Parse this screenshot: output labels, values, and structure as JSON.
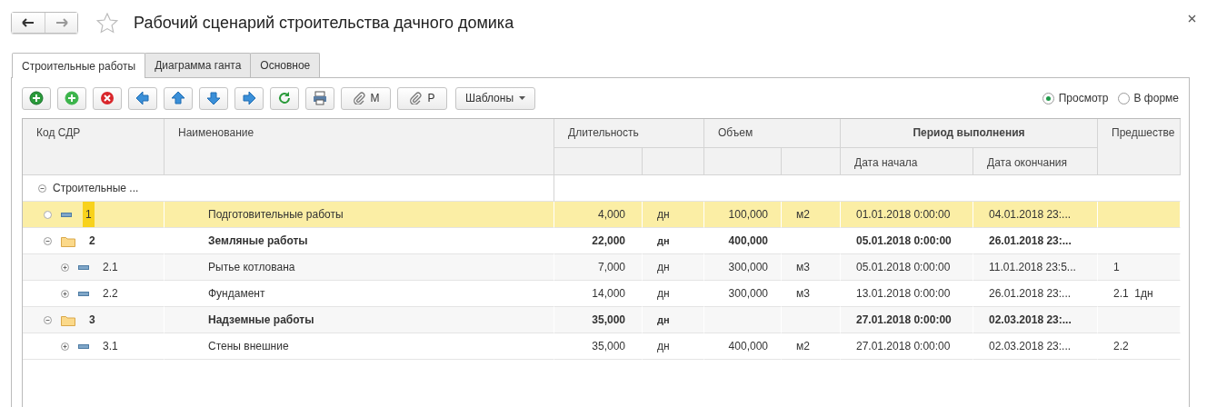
{
  "window": {
    "title": "Рабочий сценарий строительства дачного домика"
  },
  "tabs": [
    {
      "label": "Строительные работы",
      "selected": true
    },
    {
      "label": "Диаграмма ганта",
      "selected": false
    },
    {
      "label": "Основное",
      "selected": false
    }
  ],
  "toolbar": {
    "attach_buttons": [
      {
        "label": "М"
      },
      {
        "label": "Р"
      }
    ],
    "templates_button": {
      "label": "Шаблоны"
    }
  },
  "view_mode": [
    {
      "label": "Просмотр",
      "selected": true
    },
    {
      "label": "В форме",
      "selected": false
    }
  ],
  "table": {
    "columns": {
      "code": "Код СДР",
      "name": "Наименование",
      "duration": "Длительность",
      "volume": "Объем",
      "period": "Период выполнения",
      "start": "Дата начала",
      "end": "Дата окончания",
      "column_9": "Предшестве"
    },
    "tree": {
      "label": "Строительные ...",
      "expanded": true,
      "selected": false,
      "children": [
        {
          "code": "1",
          "name": "Подготовительные работы",
          "kind": "task",
          "selected": true,
          "duration": "4,000",
          "duration_unit": "дн",
          "volume": "100,000",
          "volume_unit": "м2",
          "start": "01.01.2018 0:00:00",
          "end": "04.01.2018 23:..."
        },
        {
          "code": "2",
          "name": "Земляные работы",
          "kind": "summary",
          "selected": false,
          "expanded": true,
          "duration": "22,000",
          "duration_unit": "дн",
          "volume": "400,000",
          "start": "05.01.2018 0:00:00",
          "end": "26.01.2018 23:...",
          "children": [
            {
              "code": "2.1",
              "name": "Рытье котлована",
              "kind": "task",
              "selected": false,
              "expanded": false,
              "duration": "7,000",
              "duration_unit": "дн",
              "volume": "300,000",
              "volume_unit": "м3",
              "start": "05.01.2018 0:00:00",
              "end": "11.01.2018 23:5...",
              "predecessor": "1"
            },
            {
              "code": "2.2",
              "name": "Фундамент",
              "kind": "task",
              "selected": false,
              "expanded": false,
              "duration": "14,000",
              "duration_unit": "дн",
              "volume": "300,000",
              "volume_unit": "м3",
              "start": "13.01.2018 0:00:00",
              "end": "26.01.2018 23:...",
              "predecessor": "2.1  1дн"
            }
          ]
        },
        {
          "code": "3",
          "name": "Надземные работы",
          "kind": "summary",
          "selected": false,
          "expanded": true,
          "duration": "35,000",
          "duration_unit": "дн",
          "start": "27.01.2018 0:00:00",
          "end": "02.03.2018 23:...",
          "children": [
            {
              "code": "3.1",
              "name": "Стены внешние",
              "kind": "task",
              "selected": false,
              "expanded": false,
              "duration": "35,000",
              "duration_unit": "дн",
              "volume": "400,000",
              "volume_unit": "м2",
              "start": "27.01.2018 0:00:00",
              "end": "02.03.2018 23:...",
              "predecessor": "2.2"
            }
          ]
        }
      ]
    }
  }
}
